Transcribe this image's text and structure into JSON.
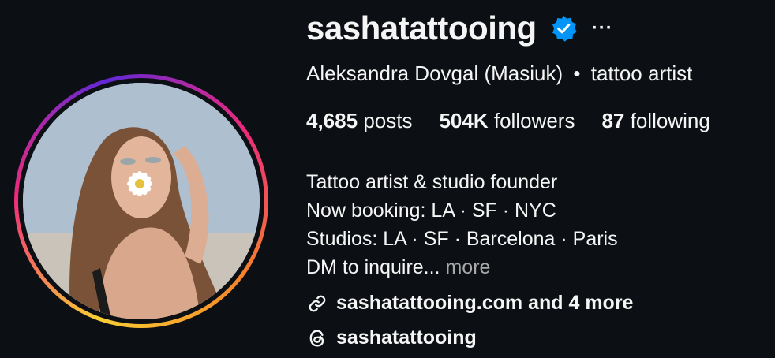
{
  "profile": {
    "username": "sashatattooing",
    "verified_icon": "verified-badge-icon",
    "more_icon_glyph": "···",
    "full_name": "Aleksandra Dovgal (Masiuk)",
    "separator": "•",
    "category": "tattoo artist",
    "avatar_alt": "profile photo"
  },
  "stats": {
    "posts_count": "4,685",
    "posts_label": "posts",
    "followers_count": "504K",
    "followers_label": "followers",
    "following_count": "87",
    "following_label": "following"
  },
  "bio": {
    "lines": [
      "Tattoo artist & studio founder",
      "Now booking: LA · SF · NYC",
      "Studios: LA · SF · Barcelona · Paris",
      "DM to inquire..."
    ],
    "more_label": "more"
  },
  "links": {
    "website": "sashatattooing.com and 4 more",
    "threads": "sashatattooing"
  },
  "colors": {
    "background": "#0c1014",
    "text": "#f5f5f5",
    "muted": "#a8a8a8",
    "verified": "#0095f6"
  }
}
